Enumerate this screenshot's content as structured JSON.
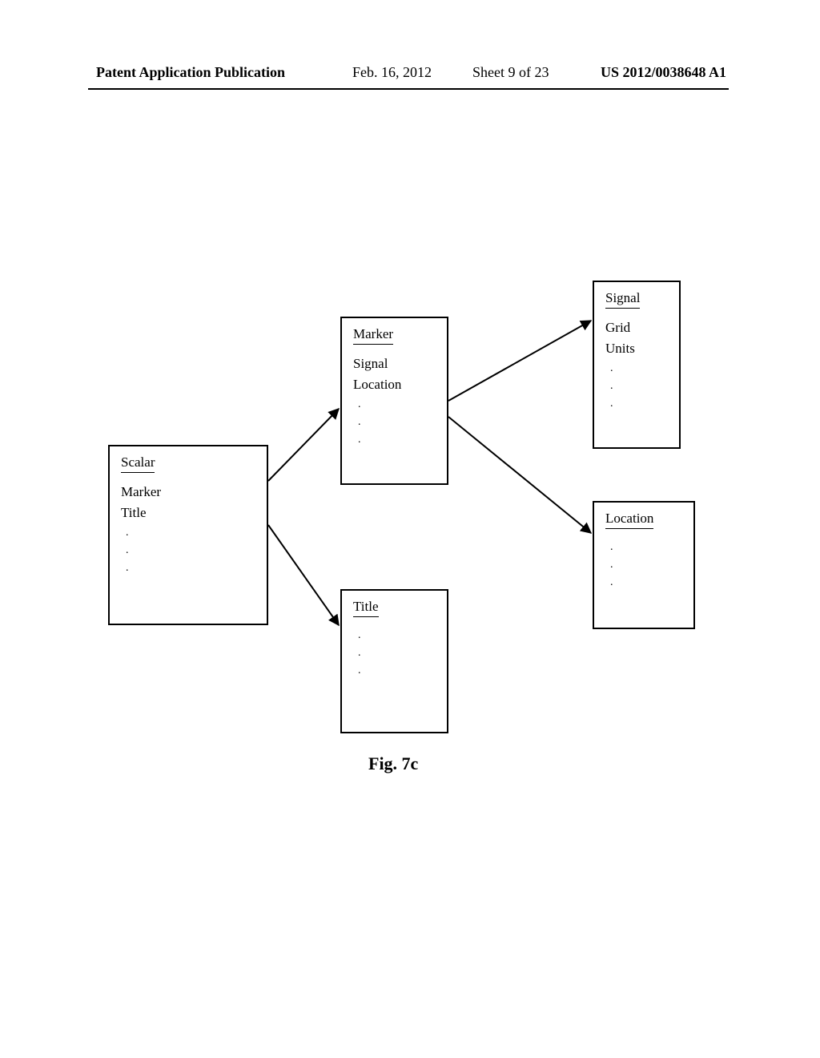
{
  "header": {
    "publication": "Patent Application Publication",
    "date": "Feb. 16, 2012",
    "sheet": "Sheet 9 of 23",
    "docnum": "US 2012/0038648 A1"
  },
  "boxes": {
    "scalar": {
      "title": "Scalar",
      "rows": [
        "Marker",
        "Title"
      ]
    },
    "marker": {
      "title": "Marker",
      "rows": [
        "Signal",
        "Location"
      ]
    },
    "title_box": {
      "title": "Title"
    },
    "signal": {
      "title": "Signal",
      "rows": [
        "Grid",
        "Units"
      ]
    },
    "location": {
      "title": "Location"
    }
  },
  "dot": ".",
  "caption": "Fig. 7c"
}
